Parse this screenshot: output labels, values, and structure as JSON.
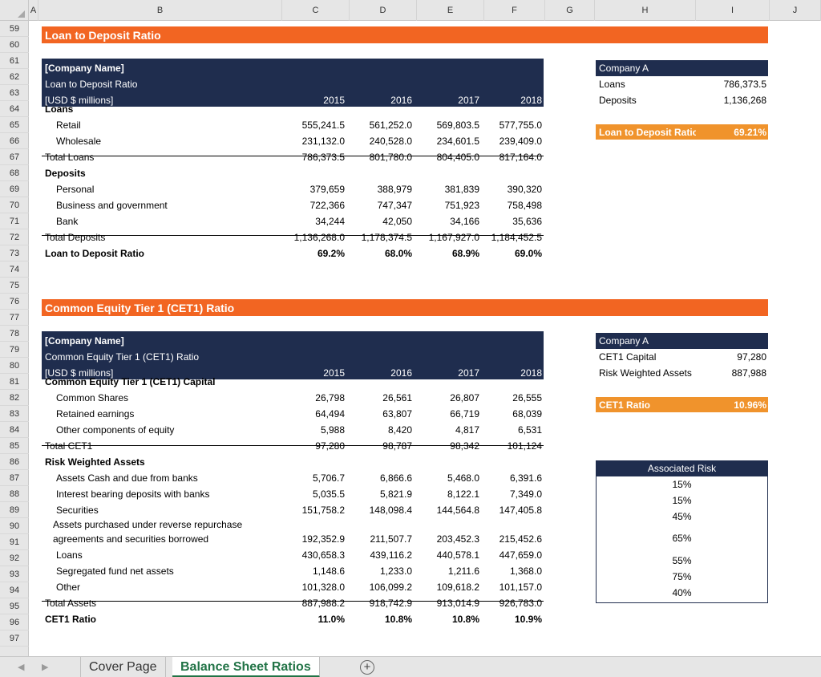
{
  "columns": [
    "A",
    "B",
    "C",
    "D",
    "E",
    "F",
    "G",
    "H",
    "I",
    "J"
  ],
  "rows": [
    "59",
    "60",
    "61",
    "62",
    "63",
    "64",
    "65",
    "66",
    "67",
    "68",
    "69",
    "70",
    "71",
    "72",
    "73",
    "74",
    "75",
    "76",
    "77",
    "78",
    "79",
    "80",
    "81",
    "82",
    "83",
    "84",
    "85",
    "86",
    "87",
    "88",
    "89",
    "90",
    "91",
    "92",
    "93",
    "94",
    "95",
    "96",
    "97"
  ],
  "ldr": {
    "title": "Loan to Deposit Ratio",
    "header": {
      "company": "[Company Name]",
      "name": "Loan to Deposit Ratio",
      "units": "[USD $ millions]"
    },
    "years": [
      "2015",
      "2016",
      "2017",
      "2018"
    ],
    "lines": [
      {
        "label": "Loans",
        "values": [
          "",
          "",
          "",
          ""
        ],
        "bold": true,
        "indent": false
      },
      {
        "label": "Retail",
        "values": [
          "555,241.5",
          "561,252.0",
          "569,803.5",
          "577,755.0"
        ],
        "bold": false,
        "indent": true
      },
      {
        "label": "Wholesale",
        "values": [
          "231,132.0",
          "240,528.0",
          "234,601.5",
          "239,409.0"
        ],
        "bold": false,
        "indent": true
      },
      {
        "label": "Total Loans",
        "values": [
          "786,373.5",
          "801,780.0",
          "804,405.0",
          "817,164.0"
        ],
        "bold": false,
        "indent": false
      },
      {
        "label": "Deposits",
        "values": [
          "",
          "",
          "",
          ""
        ],
        "bold": true,
        "indent": false
      },
      {
        "label": "Personal",
        "values": [
          "379,659",
          "388,979",
          "381,839",
          "390,320"
        ],
        "bold": false,
        "indent": true
      },
      {
        "label": "Business and government",
        "values": [
          "722,366",
          "747,347",
          "751,923",
          "758,498"
        ],
        "bold": false,
        "indent": true
      },
      {
        "label": "Bank",
        "values": [
          "34,244",
          "42,050",
          "34,166",
          "35,636"
        ],
        "bold": false,
        "indent": true
      },
      {
        "label": "Total Deposits",
        "values": [
          "1,136,268.0",
          "1,178,374.5",
          "1,167,927.0",
          "1,184,452.5"
        ],
        "bold": false,
        "indent": false
      },
      {
        "label": "Loan to Deposit Ratio",
        "values": [
          "69.2%",
          "68.0%",
          "68.9%",
          "69.0%"
        ],
        "bold": true,
        "indent": false
      }
    ],
    "summary": {
      "company": "Company A",
      "rows": [
        {
          "label": "Loans",
          "value": "786,373.5"
        },
        {
          "label": "Deposits",
          "value": "1,136,268"
        }
      ],
      "ratio_label": "Loan to Deposit Ratio",
      "ratio_value": "69.21%"
    }
  },
  "cet1": {
    "title": "Common Equity Tier 1 (CET1) Ratio",
    "header": {
      "company": "[Company Name]",
      "name": "Common Equity Tier 1 (CET1) Ratio",
      "units": "[USD $ millions]"
    },
    "years": [
      "2015",
      "2016",
      "2017",
      "2018"
    ],
    "lines": [
      {
        "label": "Common Equity Tier 1 (CET1) Capital",
        "values": [
          "",
          "",
          "",
          ""
        ],
        "bold": true,
        "indent": false
      },
      {
        "label": "Common Shares",
        "values": [
          "26,798",
          "26,561",
          "26,807",
          "26,555"
        ],
        "bold": false,
        "indent": true
      },
      {
        "label": "Retained earnings",
        "values": [
          "64,494",
          "63,807",
          "66,719",
          "68,039"
        ],
        "bold": false,
        "indent": true
      },
      {
        "label": "Other components of equity",
        "values": [
          "5,988",
          "8,420",
          "4,817",
          "6,531"
        ],
        "bold": false,
        "indent": true
      },
      {
        "label": "Total CET1",
        "values": [
          "97,280",
          "98,787",
          "98,342",
          "101,124"
        ],
        "bold": false,
        "indent": false
      },
      {
        "label": "Risk Weighted Assets",
        "values": [
          "",
          "",
          "",
          ""
        ],
        "bold": true,
        "indent": false
      },
      {
        "label": "Assets Cash and due from banks",
        "values": [
          "5,706.7",
          "6,866.6",
          "5,468.0",
          "6,391.6"
        ],
        "bold": false,
        "indent": true
      },
      {
        "label": "Interest bearing deposits with banks",
        "values": [
          "5,035.5",
          "5,821.9",
          "8,122.1",
          "7,349.0"
        ],
        "bold": false,
        "indent": true
      },
      {
        "label": "Securities",
        "values": [
          "151,758.2",
          "148,098.4",
          "144,564.8",
          "147,405.8"
        ],
        "bold": false,
        "indent": true
      },
      {
        "label": "Assets purchased under reverse repurchase",
        "label2": "agreements and securities borrowed",
        "values": [
          "192,352.9",
          "211,507.7",
          "203,452.3",
          "215,452.6"
        ],
        "bold": false,
        "indent": true
      },
      {
        "label": "Loans",
        "values": [
          "430,658.3",
          "439,116.2",
          "440,578.1",
          "447,659.0"
        ],
        "bold": false,
        "indent": true
      },
      {
        "label": "Segregated fund net assets",
        "values": [
          "1,148.6",
          "1,233.0",
          "1,211.6",
          "1,368.0"
        ],
        "bold": false,
        "indent": true
      },
      {
        "label": "Other",
        "values": [
          "101,328.0",
          "106,099.2",
          "109,618.2",
          "101,157.0"
        ],
        "bold": false,
        "indent": true
      },
      {
        "label": "Total Assets",
        "values": [
          "887,988.2",
          "918,742.9",
          "913,014.9",
          "926,783.0"
        ],
        "bold": false,
        "indent": false
      },
      {
        "label": "CET1 Ratio",
        "values": [
          "11.0%",
          "10.8%",
          "10.8%",
          "10.9%"
        ],
        "bold": true,
        "indent": false
      }
    ],
    "summary": {
      "company": "Company A",
      "rows": [
        {
          "label": "CET1 Capital",
          "value": "97,280"
        },
        {
          "label": "Risk Weighted Assets",
          "value": "887,988"
        }
      ],
      "ratio_label": "CET1 Ratio",
      "ratio_value": "10.96%"
    },
    "risk": {
      "header": "Associated Risk",
      "values": [
        "15%",
        "15%",
        "45%",
        "65%",
        "55%",
        "75%",
        "40%"
      ]
    }
  },
  "tabs": [
    "Cover Page",
    "Balance Sheet Ratios"
  ],
  "active_tab": "Balance Sheet Ratios",
  "colors": {
    "orange": "#f26522",
    "navy": "#1f2d4e",
    "gold": "#f0932c",
    "tab_green": "#217346"
  }
}
